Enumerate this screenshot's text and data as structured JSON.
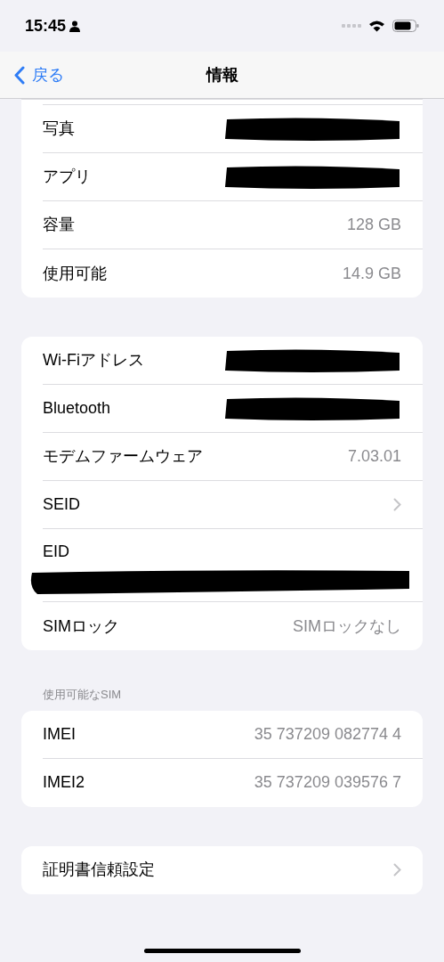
{
  "status_bar": {
    "time": "15:45"
  },
  "nav": {
    "back": "戻る",
    "title": "情報"
  },
  "sections": [
    {
      "cut_top": true,
      "rows": [
        {
          "label": "写真",
          "kind": "redacted"
        },
        {
          "label": "アプリ",
          "kind": "redacted"
        },
        {
          "label": "容量",
          "kind": "value",
          "value": "128 GB"
        },
        {
          "label": "使用可能",
          "kind": "value",
          "value": "14.9 GB"
        }
      ]
    },
    {
      "cut_top": false,
      "rows": [
        {
          "label": "Wi-Fiアドレス",
          "kind": "redacted"
        },
        {
          "label": "Bluetooth",
          "kind": "redacted"
        },
        {
          "label": "モデムファームウェア",
          "kind": "value",
          "value": "7.03.01"
        },
        {
          "label": "SEID",
          "kind": "chevron"
        },
        {
          "label": "EID",
          "kind": "redacted_below"
        },
        {
          "label": "SIMロック",
          "kind": "value",
          "value": "SIMロックなし"
        }
      ]
    },
    {
      "cut_top": false,
      "header": "使用可能なSIM",
      "rows": [
        {
          "label": "IMEI",
          "kind": "value",
          "value": "35 737209 082774 4"
        },
        {
          "label": "IMEI2",
          "kind": "value",
          "value": "35 737209 039576 7"
        }
      ]
    },
    {
      "cut_top": false,
      "rows": [
        {
          "label": "証明書信頼設定",
          "kind": "chevron"
        }
      ]
    }
  ]
}
